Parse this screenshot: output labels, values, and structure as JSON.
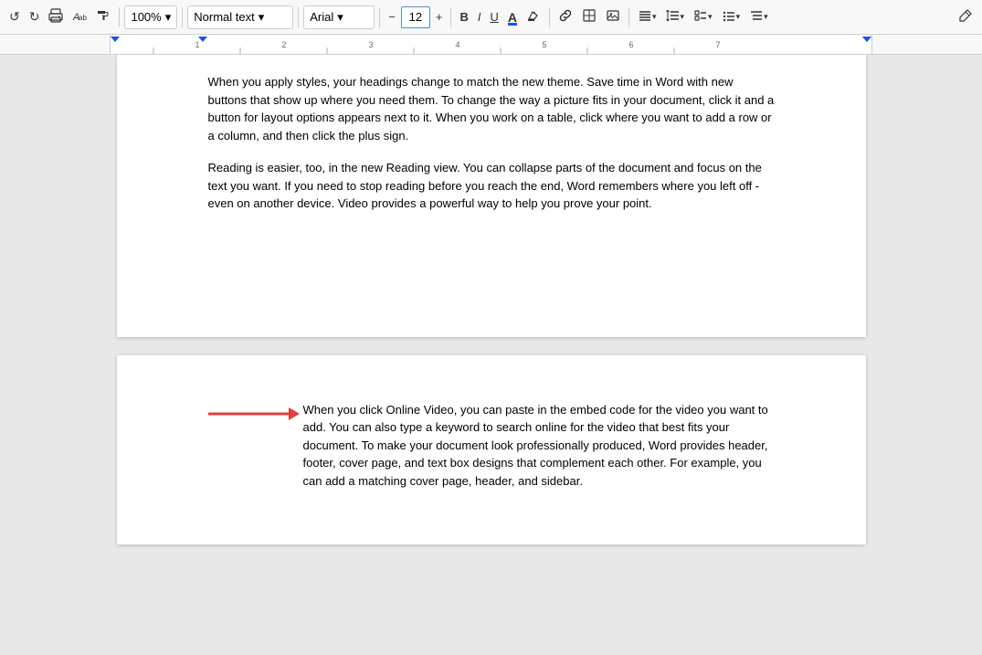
{
  "toolbar": {
    "undo_label": "↩",
    "redo_label": "↪",
    "print_label": "🖨",
    "paint_format_label": "🎨",
    "zoom_value": "100%",
    "style_label": "Normal text",
    "font_label": "Arial",
    "font_size": "12",
    "decrease_font_label": "−",
    "increase_font_label": "+",
    "bold_label": "B",
    "italic_label": "I",
    "underline_label": "U",
    "font_color_label": "A",
    "highlight_label": "✏",
    "link_label": "🔗",
    "equation_label": "⊞",
    "image_label": "🖼",
    "align_label": "≡",
    "line_spacing_label": "↕",
    "checklist_label": "☑",
    "list_label": "≡",
    "more_label": "≡",
    "edit_label": "✏"
  },
  "page1": {
    "para1": "When you apply styles, your headings change to match the new theme. Save time in Word with new buttons that show up where you need them. To change the way a picture fits in your document, click it and a button for layout options appears next to it. When you work on a table, click where you want to add a row or a column, and then click the plus sign.",
    "para2": "Reading is easier, too, in the new Reading view. You can collapse parts of the document and focus on the text you want. If you need to stop reading before you reach the end, Word remembers where you left off - even on another device. Video provides a powerful way to help you prove your point."
  },
  "page2": {
    "para1": "When you click Online Video, you can paste in the embed code for the video you want to add. You can also type a keyword to search online for the video that best fits your document. To make your document look professionally produced, Word provides header, footer, cover page, and text box designs that complement each other. For example, you can add a matching cover page, header, and sidebar."
  },
  "ruler": {
    "marks": [
      "1",
      "2",
      "3",
      "4",
      "5",
      "6",
      "7"
    ]
  }
}
